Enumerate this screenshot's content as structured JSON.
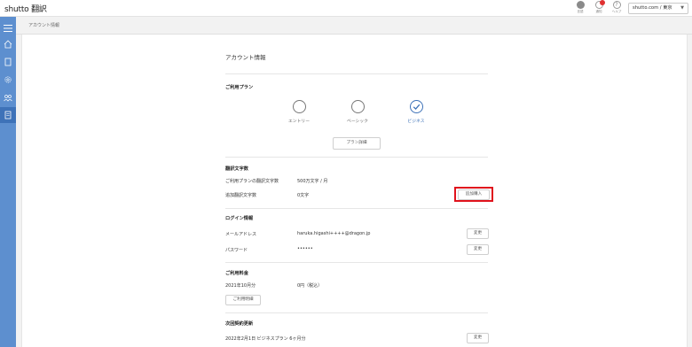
{
  "header": {
    "logo": "shutto 翻訳",
    "icons": [
      {
        "name": "globe-icon",
        "caption": "言語"
      },
      {
        "name": "bell-icon",
        "caption": "通知"
      },
      {
        "name": "help-icon",
        "caption": "ヘルプ"
      }
    ],
    "region_select": "shutto.com / 東京"
  },
  "breadcrumb": "アカウント情報",
  "page_title": "アカウント情報",
  "plan": {
    "title": "ご利用プラン",
    "options": [
      {
        "label": "エントリー",
        "selected": false
      },
      {
        "label": "ベーシック",
        "selected": false
      },
      {
        "label": "ビジネス",
        "selected": true
      }
    ],
    "details_button": "プラン詳細"
  },
  "translation": {
    "title": "翻訳文字数",
    "rows": [
      {
        "label": "ご利用プランの翻訳文字数",
        "value": "500万文字 / 月"
      },
      {
        "label": "追加翻訳文字数",
        "value": "0文字"
      }
    ],
    "buy_button": "追加購入"
  },
  "login": {
    "title": "ログイン情報",
    "email_label": "メールアドレス",
    "email_value": "haruka.higashi++++@dragon.jp",
    "password_label": "パスワード",
    "password_value": "••••••",
    "change_label": "変更"
  },
  "fee": {
    "title": "ご利用料金",
    "month": "2021年10月分",
    "amount": "0円（税込）",
    "history_button": "ご利用明細"
  },
  "renewal": {
    "title": "次回契約更新",
    "text": "2022年2月1日 ビジネスプラン 6ヶ月分",
    "change_label": "変更"
  },
  "colors": {
    "accent": "#3e72b8",
    "sidebar": "#5d8fcf",
    "highlight": "#e0121c"
  }
}
